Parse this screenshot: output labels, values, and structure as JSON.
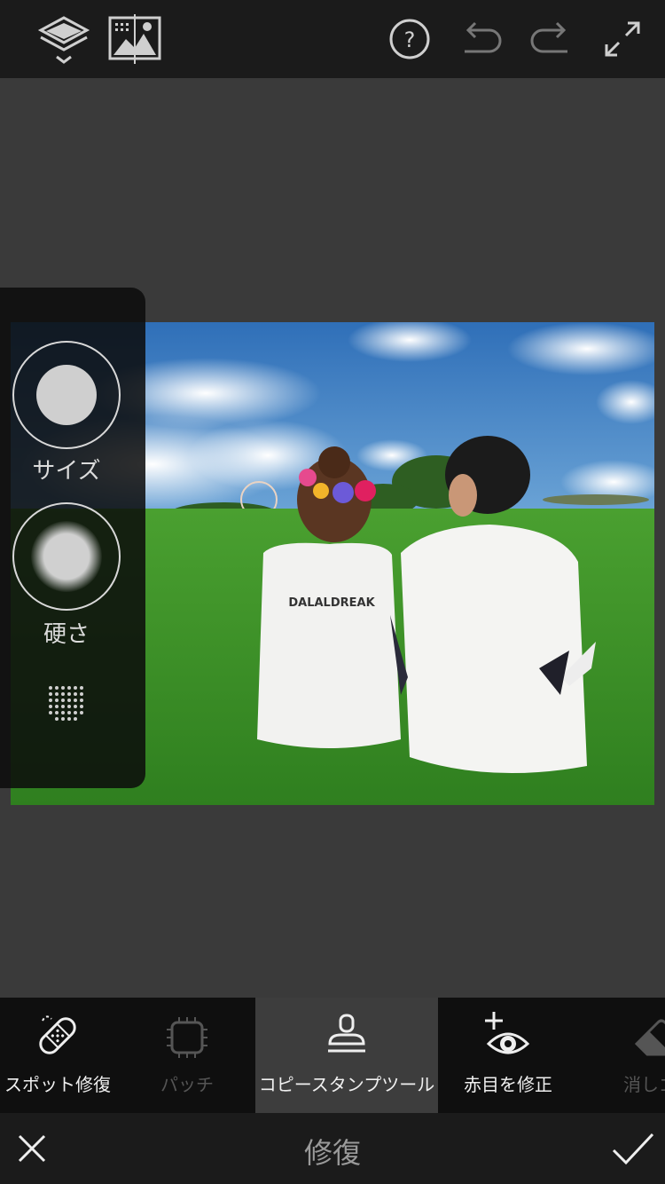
{
  "topbar": {
    "icons": [
      "layers-icon",
      "image-compare-icon",
      "help-icon",
      "undo-icon",
      "redo-icon",
      "fullscreen-icon"
    ]
  },
  "side_panel": {
    "size_label": "サイズ",
    "hardness_label": "硬さ",
    "opacity_icon": "dot-grid-icon"
  },
  "tools": [
    {
      "label": "スポット修復",
      "icon": "bandage-icon",
      "state": "normal"
    },
    {
      "label": "パッチ",
      "icon": "patch-icon",
      "state": "disabled"
    },
    {
      "label": "コピースタンプツール",
      "icon": "clone-stamp-icon",
      "state": "active"
    },
    {
      "label": "赤目を修正",
      "icon": "red-eye-icon",
      "state": "normal"
    },
    {
      "label": "消しゴム",
      "icon": "eraser-icon",
      "state": "disabled"
    }
  ],
  "photo": {
    "shirt_text": "DALALDREAK"
  },
  "bottombar": {
    "title": "修復",
    "cancel_icon": "close-icon",
    "confirm_icon": "check-icon"
  },
  "colors": {
    "bar_bg": "#1b1b1b",
    "canvas_bg": "#3a3a3a",
    "toolbar_bg": "#0f0f0f",
    "active_tool_bg": "#3d3d3d"
  }
}
